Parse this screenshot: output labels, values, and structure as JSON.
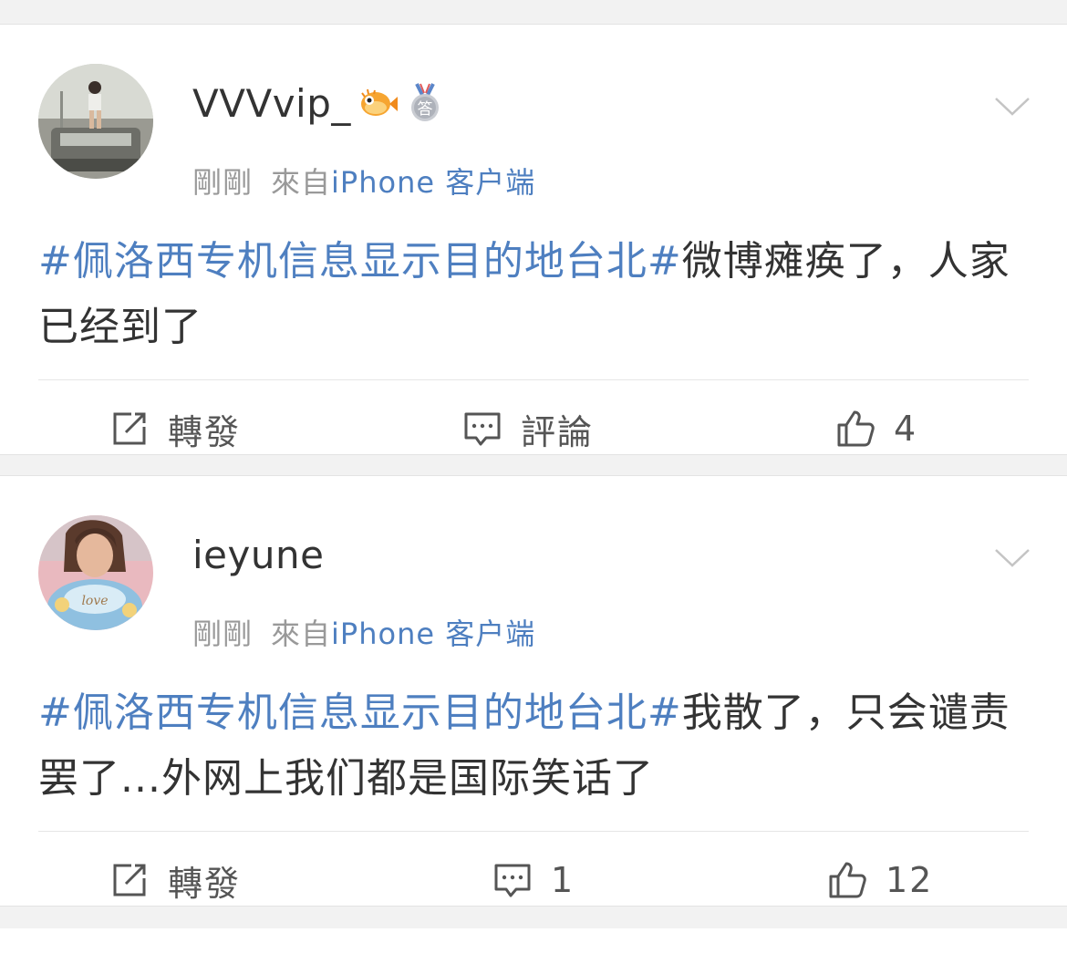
{
  "posts": [
    {
      "username": "VVVvip_",
      "badges": [
        "pufferfish-badge-icon",
        "silver-answer-medal-icon"
      ],
      "badge_medal_char": "答",
      "time": "剛剛",
      "source_prefix": "來自",
      "source_client": "iPhone 客户端",
      "topic": "#佩洛西专机信息显示目的地台北#",
      "text": "微博瘫痪了，人家已经到了",
      "repost_label": "轉發",
      "comment_label": "評論",
      "like_count": "4"
    },
    {
      "username": "ieyune",
      "badges": [],
      "time": "剛剛",
      "source_prefix": "來自",
      "source_client": "iPhone 客户端",
      "topic": "#佩洛西专机信息显示目的地台北#",
      "text": "我散了，只会谴责罢了...外网上我们都是国际笑话了",
      "repost_label": "轉發",
      "comment_label": "1",
      "like_count": "12"
    }
  ],
  "colors": {
    "link_blue": "#4e7fc0",
    "text_dark": "#333333",
    "text_gray": "#999999",
    "separator": "#f2f2f2"
  }
}
